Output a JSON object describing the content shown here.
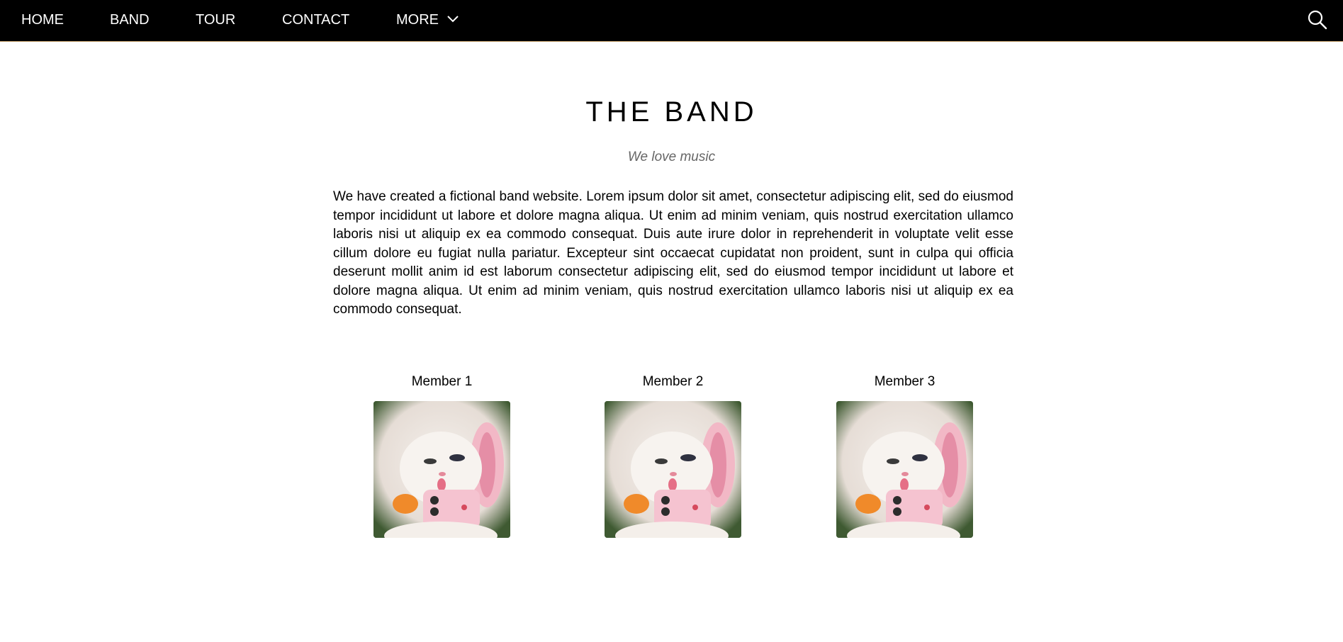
{
  "nav": {
    "items": [
      {
        "label": "HOME"
      },
      {
        "label": "BAND"
      },
      {
        "label": "TOUR"
      },
      {
        "label": "CONTACT"
      },
      {
        "label": "MORE"
      }
    ],
    "search_icon": "search-icon",
    "more_icon": "chevron-down-icon"
  },
  "section": {
    "title": "THE BAND",
    "subtitle": "We love music",
    "description": "We have created a fictional band website. Lorem ipsum dolor sit amet, consectetur adipiscing elit, sed do eiusmod tempor incididunt ut labore et dolore magna aliqua. Ut enim ad minim veniam, quis nostrud exercitation ullamco laboris nisi ut aliquip ex ea commodo consequat. Duis aute irure dolor in reprehenderit in voluptate velit esse cillum dolore eu fugiat nulla pariatur. Excepteur sint occaecat cupidatat non proident, sunt in culpa qui officia deserunt mollit anim id est laborum consectetur adipiscing elit, sed do eiusmod tempor incididunt ut labore et dolore magna aliqua. Ut enim ad minim veniam, quis nostrud exercitation ullamco laboris nisi ut aliquip ex ea commodo consequat."
  },
  "members": [
    {
      "name": "Member 1"
    },
    {
      "name": "Member 2"
    },
    {
      "name": "Member 3"
    }
  ],
  "colors": {
    "nav_bg": "#000000",
    "nav_text": "#ffffff",
    "subtitle": "#666666"
  }
}
